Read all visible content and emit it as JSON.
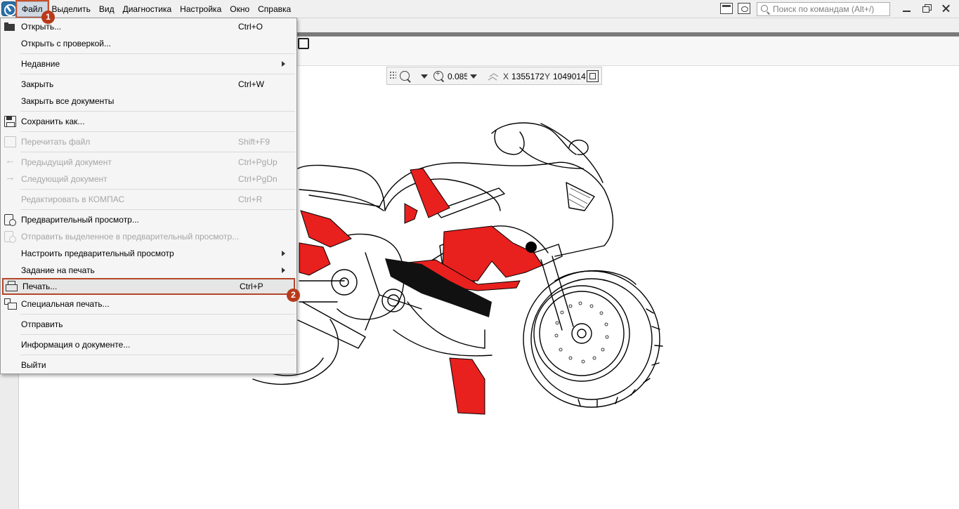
{
  "menubar": {
    "items": [
      {
        "label": "Файл"
      },
      {
        "label": "Выделить"
      },
      {
        "label": "Вид"
      },
      {
        "label": "Диагностика"
      },
      {
        "label": "Настройка"
      },
      {
        "label": "Окно"
      },
      {
        "label": "Справка"
      }
    ],
    "active_item": "Файл",
    "search_placeholder": "Поиск по командам (Alt+/)"
  },
  "view_toolbar": {
    "zoom_value": "0.085",
    "x_label": "X",
    "x_value": "1355172",
    "y_label": "Y",
    "y_value": "1049014"
  },
  "file_menu": {
    "items": [
      {
        "label": "Открыть...",
        "shortcut": "Ctrl+O",
        "icon": "folder-open-icon",
        "enabled": true
      },
      {
        "label": "Открыть с проверкой...",
        "shortcut": "",
        "enabled": true
      },
      {
        "label": "Недавние",
        "shortcut": "",
        "submenu": true,
        "enabled": true
      },
      {
        "label": "Закрыть",
        "shortcut": "Ctrl+W",
        "enabled": true
      },
      {
        "label": "Закрыть все документы",
        "shortcut": "",
        "enabled": true
      },
      {
        "label": "Сохранить как...",
        "shortcut": "",
        "icon": "save-icon",
        "enabled": true
      },
      {
        "label": "Перечитать файл",
        "shortcut": "Shift+F9",
        "icon": "reread-icon",
        "enabled": false
      },
      {
        "label": "Предыдущий документ",
        "shortcut": "Ctrl+PgUp",
        "icon": "arrow-left-icon",
        "enabled": false
      },
      {
        "label": "Следующий документ",
        "shortcut": "Ctrl+PgDn",
        "icon": "arrow-right-icon",
        "enabled": false
      },
      {
        "label": "Редактировать в КОМПАС",
        "shortcut": "Ctrl+R",
        "enabled": false
      },
      {
        "label": "Предварительный просмотр...",
        "shortcut": "",
        "icon": "preview-icon",
        "enabled": true
      },
      {
        "label": "Отправить выделенное в предварительный просмотр...",
        "shortcut": "",
        "icon": "preview-icon",
        "enabled": false
      },
      {
        "label": "Настроить предварительный просмотр",
        "shortcut": "",
        "submenu": true,
        "enabled": true
      },
      {
        "label": "Задание на печать",
        "shortcut": "",
        "submenu": true,
        "enabled": true
      },
      {
        "label": "Печать...",
        "shortcut": "Ctrl+P",
        "icon": "printer-icon",
        "enabled": true,
        "selected": true
      },
      {
        "label": "Специальная печать...",
        "shortcut": "",
        "icon": "special-print-icon",
        "enabled": true
      },
      {
        "label": "Отправить",
        "shortcut": "",
        "enabled": true
      },
      {
        "label": "Информация о документе...",
        "shortcut": "",
        "enabled": true
      },
      {
        "label": "Выйти",
        "shortcut": "",
        "enabled": true
      }
    ]
  },
  "callouts": [
    {
      "label": "1"
    },
    {
      "label": "2"
    }
  ],
  "colors": {
    "accent_highlight": "#b5452a",
    "callout": "#b83a1b",
    "livery_red": "#e8201e"
  }
}
